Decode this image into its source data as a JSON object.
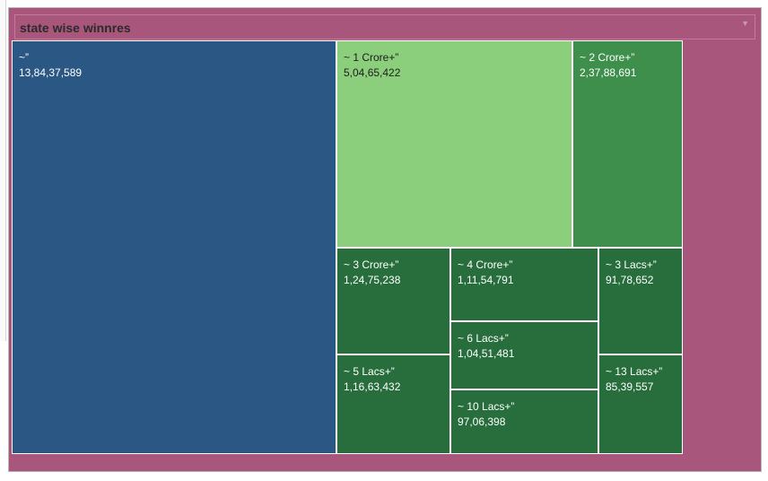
{
  "dashboard": {
    "title": "state wise winnres"
  },
  "icons": {
    "dropdown": "chevron-down-icon"
  },
  "colors": {
    "frame": "#a9567c",
    "largest": "#2a5783",
    "light_green": "#8bce7c",
    "mid_green": "#3d8f4b",
    "dark_green": "#276e3c"
  },
  "chart_data": {
    "type": "treemap",
    "title": "state wise winnres",
    "tiles": [
      {
        "label": "~”",
        "value_text": "13,84,37,589",
        "value": 138437589,
        "color": "#2a5783",
        "light": false
      },
      {
        "label": "~ 1 Crore+”",
        "value_text": "5,04,65,422",
        "value": 50465422,
        "color": "#8bce7c",
        "light": true
      },
      {
        "label": "~ 2 Crore+”",
        "value_text": "2,37,88,691",
        "value": 23788691,
        "color": "#3d8f4b",
        "light": false
      },
      {
        "label": "~ 3 Crore+”",
        "value_text": "1,24,75,238",
        "value": 12475238,
        "color": "#276e3c",
        "light": false
      },
      {
        "label": "~ 4 Crore+”",
        "value_text": "1,11,54,791",
        "value": 11154791,
        "color": "#276e3c",
        "light": false
      },
      {
        "label": "~ 3 Lacs+”",
        "value_text": "91,78,652",
        "value": 9178652,
        "color": "#276e3c",
        "light": false
      },
      {
        "label": "~ 6 Lacs+”",
        "value_text": "1,04,51,481",
        "value": 10451481,
        "color": "#276e3c",
        "light": false
      },
      {
        "label": "~ 5 Lacs+”",
        "value_text": "1,16,63,432",
        "value": 11663432,
        "color": "#276e3c",
        "light": false
      },
      {
        "label": "~ 13 Lacs+”",
        "value_text": "85,39,557",
        "value": 8539557,
        "color": "#276e3c",
        "light": false
      },
      {
        "label": "~ 10 Lacs+”",
        "value_text": "97,06,398",
        "value": 9706398,
        "color": "#276e3c",
        "light": false
      }
    ]
  }
}
